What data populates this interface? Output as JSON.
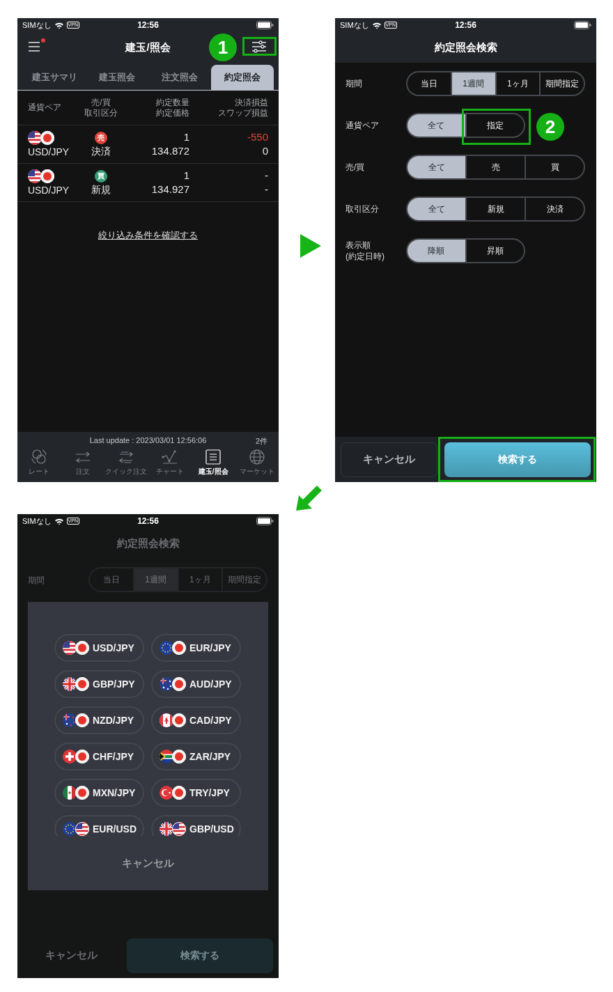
{
  "positions_screen": {
    "status_bar": {
      "carrier": "SIMなし",
      "vpn": "VPN",
      "time": "12:56"
    },
    "title": "建玉/照会",
    "menu_badge": true,
    "tabs": [
      {
        "label": "建玉サマリ",
        "selected": false
      },
      {
        "label": "建玉照会",
        "selected": false
      },
      {
        "label": "注文照会",
        "selected": false
      },
      {
        "label": "約定照会",
        "selected": true
      }
    ],
    "columns": [
      {
        "lines": [
          "通貨ペア"
        ]
      },
      {
        "lines": [
          "売/買",
          "取引区分"
        ]
      },
      {
        "lines": [
          "約定数量",
          "約定価格"
        ]
      },
      {
        "lines": [
          "決済損益",
          "スワップ損益"
        ]
      }
    ],
    "rows": [
      {
        "kind": "us_jp",
        "pair": "USD/JPY",
        "side": "売",
        "color": "#e0453b",
        "trade_type": "決済",
        "quantity": "1",
        "price": "134.872",
        "settlement_pl": "-550",
        "pl_negative": true,
        "swap_pl": "0"
      },
      {
        "kind": "us_jp",
        "pair": "USD/JPY",
        "side": "買",
        "color": "#3a9d76",
        "trade_type": "新規",
        "quantity": "1",
        "price": "134.927",
        "settlement_pl": "-",
        "pl_negative": false,
        "swap_pl": "-"
      }
    ],
    "filter_link": "絞り込み条件を確認する",
    "last_update": "Last update : 2023/03/01 12:56:06",
    "count": "2件",
    "nav": [
      {
        "kind": "rate",
        "label": "レート",
        "selected": false
      },
      {
        "kind": "order",
        "label": "注文",
        "selected": false
      },
      {
        "kind": "quick",
        "label": "クイック注文",
        "selected": false
      },
      {
        "kind": "chart",
        "label": "チャート",
        "selected": false
      },
      {
        "kind": "positions",
        "label": "建玉/照会",
        "selected": true
      },
      {
        "kind": "market",
        "label": "マーケット",
        "selected": false
      }
    ]
  },
  "search_screen": {
    "status_bar": {
      "carrier": "SIMなし",
      "vpn": "VPN",
      "time": "12:56"
    },
    "title": "約定照会検索",
    "filters": [
      {
        "label": "期間",
        "options": [
          {
            "label": "当日",
            "selected": false
          },
          {
            "label": "1週間",
            "selected": true
          },
          {
            "label": "1ヶ月",
            "selected": false
          },
          {
            "label": "期間指定",
            "selected": false
          }
        ]
      },
      {
        "label": "通貨ペア",
        "options": [
          {
            "label": "全て",
            "selected": true
          },
          {
            "label": "指定",
            "selected": false
          }
        ]
      },
      {
        "label": "売/買",
        "options": [
          {
            "label": "全て",
            "selected": true
          },
          {
            "label": "売",
            "selected": false
          },
          {
            "label": "買",
            "selected": false
          }
        ]
      },
      {
        "label": "取引区分",
        "options": [
          {
            "label": "全て",
            "selected": true
          },
          {
            "label": "新規",
            "selected": false
          },
          {
            "label": "決済",
            "selected": false
          }
        ]
      },
      {
        "label": "表示順",
        "sublabel": "(約定日時)",
        "options": [
          {
            "label": "降順",
            "selected": true
          },
          {
            "label": "昇順",
            "selected": false
          }
        ]
      }
    ],
    "cancel": "キャンセル",
    "search": "検索する"
  },
  "picker_screen": {
    "status_bar": {
      "carrier": "SIMなし",
      "vpn": "VPN",
      "time": "12:56"
    },
    "title": "約定照会検索",
    "filter": {
      "label": "期間",
      "options": [
        {
          "label": "当日",
          "selected": false
        },
        {
          "label": "1週間",
          "selected": true
        },
        {
          "label": "1ヶ月",
          "selected": false
        },
        {
          "label": "期間指定",
          "selected": false
        }
      ]
    },
    "pairs": [
      {
        "kind": "us_jp",
        "label": "USD/JPY"
      },
      {
        "kind": "eu_jp",
        "label": "EUR/JPY"
      },
      {
        "kind": "gb_jp",
        "label": "GBP/JPY"
      },
      {
        "kind": "au_jp",
        "label": "AUD/JPY"
      },
      {
        "kind": "nz_jp",
        "label": "NZD/JPY"
      },
      {
        "kind": "ca_jp",
        "label": "CAD/JPY"
      },
      {
        "kind": "ch_jp",
        "label": "CHF/JPY"
      },
      {
        "kind": "za_jp",
        "label": "ZAR/JPY"
      },
      {
        "kind": "mx_jp",
        "label": "MXN/JPY"
      },
      {
        "kind": "tr_jp",
        "label": "TRY/JPY"
      },
      {
        "kind": "eu_us",
        "label": "EUR/USD"
      },
      {
        "kind": "gb_us",
        "label": "GBP/USD"
      }
    ],
    "modal_cancel": "キャンセル",
    "cancel": "キャンセル",
    "search": "検索する"
  },
  "callouts": [
    {
      "label": "1"
    },
    {
      "label": "2"
    }
  ]
}
